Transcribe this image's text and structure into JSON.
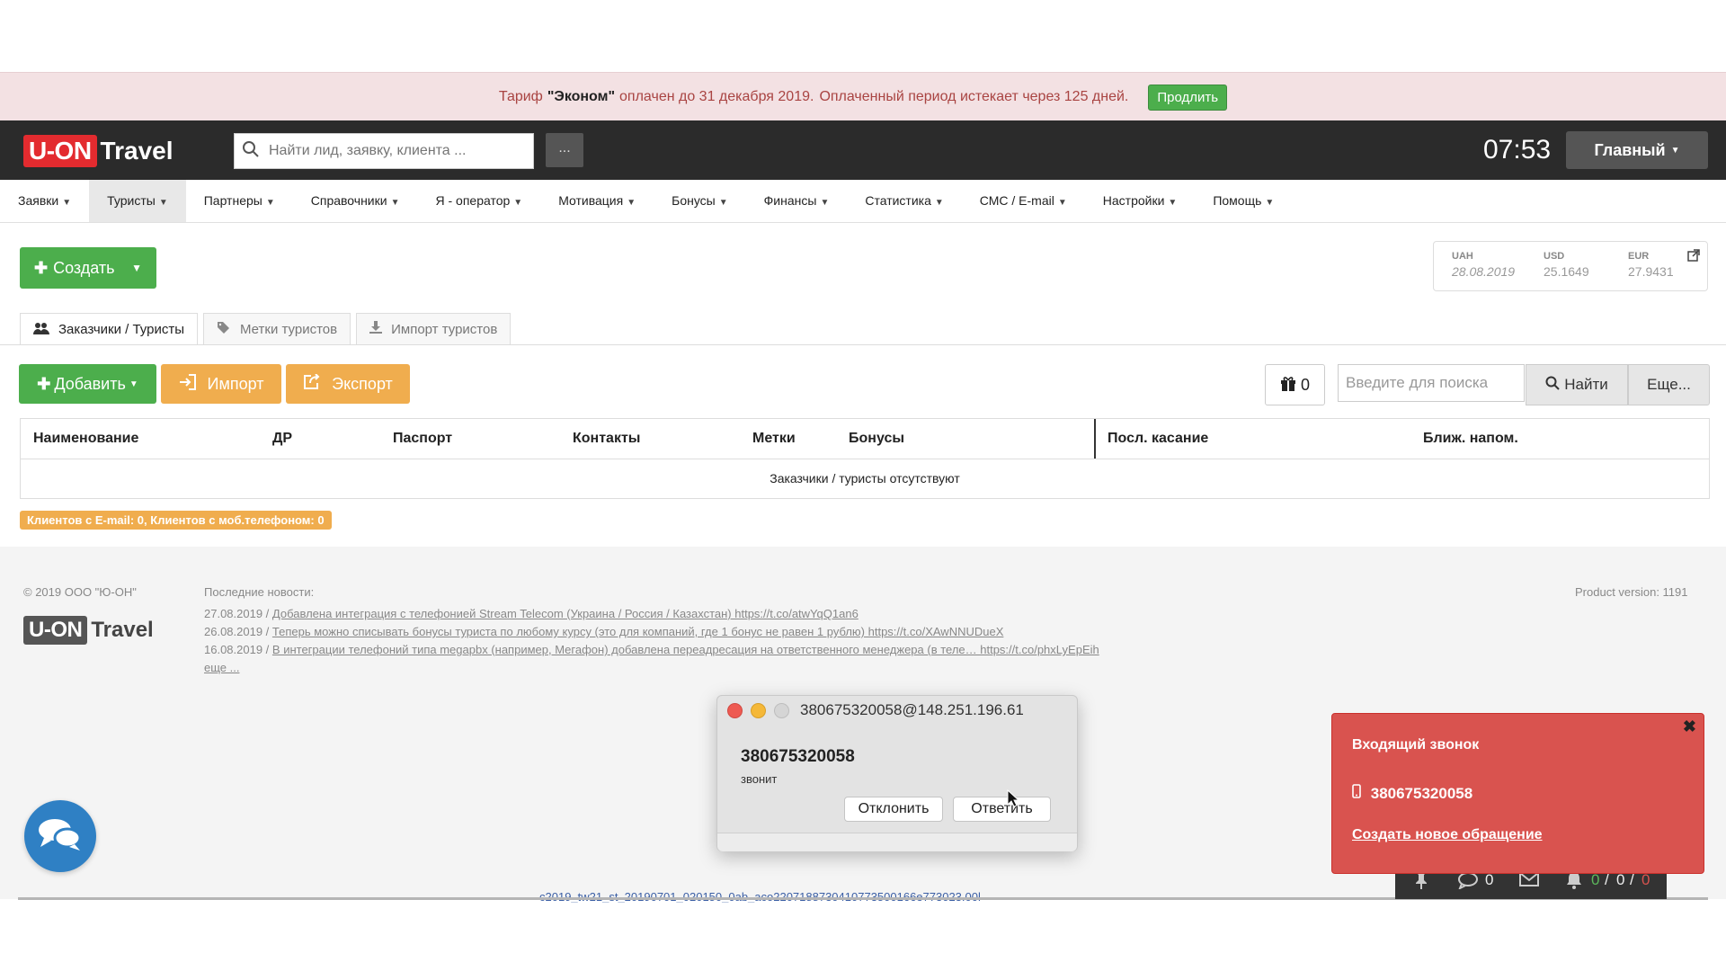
{
  "banner": {
    "prefix": "Тариф",
    "plan": "\"Эконом\"",
    "paid_until": "оплачен до 31 декабря 2019.",
    "expires": "Оплаченный период истекает через 125 дней.",
    "renew_label": "Продлить"
  },
  "header": {
    "logo_u": "U-ON",
    "logo_travel": "Travel",
    "search_placeholder": "Найти лид, заявку, клиента ...",
    "more_label": "...",
    "clock": "07:53",
    "main_label": "Главный"
  },
  "nav": {
    "items": [
      {
        "label": "Заявки"
      },
      {
        "label": "Туристы"
      },
      {
        "label": "Партнеры"
      },
      {
        "label": "Справочники"
      },
      {
        "label": "Я - оператор"
      },
      {
        "label": "Мотивация"
      },
      {
        "label": "Бонусы"
      },
      {
        "label": "Финансы"
      },
      {
        "label": "Статистика"
      },
      {
        "label": "СМС / E-mail"
      },
      {
        "label": "Настройки"
      },
      {
        "label": "Помощь"
      }
    ]
  },
  "create_label": "Создать",
  "rates": {
    "uah_label": "UAH",
    "uah_date": "28.08.2019",
    "usd_label": "USD",
    "usd_value": "25.1649",
    "eur_label": "EUR",
    "eur_value": "27.9431"
  },
  "tabs": [
    {
      "label": "Заказчики / Туристы"
    },
    {
      "label": "Метки туристов"
    },
    {
      "label": "Импорт туристов"
    }
  ],
  "toolbar": {
    "add_label": "Добавить",
    "import_label": "Импорт",
    "export_label": "Экспорт",
    "gift_count": "0",
    "search_placeholder": "Введите для поиска",
    "find_label": "Найти",
    "more_label": "Еще..."
  },
  "table": {
    "columns": [
      "Наименование",
      "ДР",
      "Паспорт",
      "Контакты",
      "Метки",
      "Бонусы",
      "Посл. касание",
      "Ближ. напом."
    ],
    "empty_text": "Заказчики / туристы отсутствуют"
  },
  "stats_text": "Клиентов с E-mail: 0, Клиентов с моб.телефоном: 0",
  "footer": {
    "copyright": "© 2019 ООО \"Ю-ОН\"",
    "news_title": "Последние новости:",
    "news": [
      {
        "date": "27.08.2019 /",
        "text": "Добавлена интеграция с телефонией Stream Telecom (Украина / Россия / Казахстан) https://t.co/atwYqQ1an6"
      },
      {
        "date": "26.08.2019 /",
        "text": "Теперь можно списывать бонусы туриста по любому курсу (это для компаний, где 1 бонус не равен 1 рублю) https://t.co/XAwNNUDueX"
      },
      {
        "date": "16.08.2019 /",
        "text": "В интеграции телефоний типа megapbx (например, Мегафон) добавлена переадресация на ответственного менеджера (в теле… https://t.co/phxLyEpEih"
      }
    ],
    "more_news": "еще ...",
    "version": "Product version: 1191"
  },
  "call_dialog": {
    "title": "380675320058@148.251.196.61",
    "number": "380675320058",
    "status": "звонит",
    "decline_label": "Отклонить",
    "answer_label": "Ответить"
  },
  "toast": {
    "close": "✖",
    "title": "Входящий звонок",
    "phone": "380675320058",
    "link": "Создать новое обращение"
  },
  "statusbar": {
    "messages": "0",
    "count_a": "0",
    "sep1": "/",
    "count_b": "0",
    "sep2": "/",
    "count_c": "0"
  },
  "under_text": "с2019_tw21_st_20190701_020150_0ab_aco2207188730410773500166e773023.00l",
  "colors": {
    "green": "#4cae4c",
    "orange": "#f0ad4e",
    "red_toast": "#d9534f",
    "logo_red": "#e32b2f",
    "header_dark": "#2b2b2b"
  }
}
